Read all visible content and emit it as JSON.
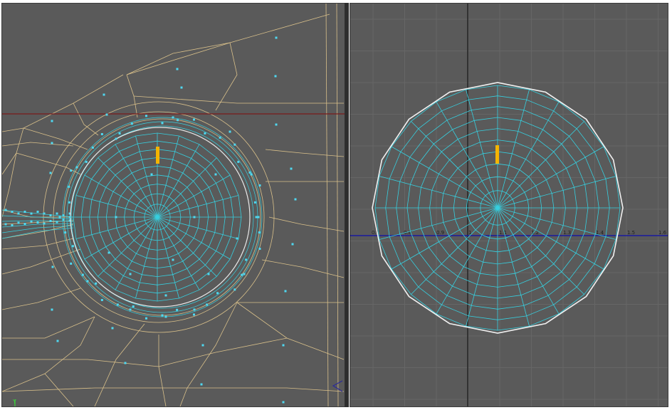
{
  "colors": {
    "viewport_bg": "#5a5a5a",
    "grid": "#666666",
    "wire_yellow": "#d9c08a",
    "wire_cyan": "#36d0e0",
    "vertex": "#4fd8f0",
    "selected_edge": "#ffffff",
    "pivot_marker": "#f4b400",
    "horizon_line": "#7a1a1a",
    "x_axis_line": "#1a1aa0",
    "y_axis_line": "#141414",
    "gizmo_green": "#3ad23a"
  },
  "viewport_left": {
    "axis_gizmo_label": "Y"
  },
  "viewport_right": {
    "axis_ticks": [
      "0.7",
      "0.8",
      "0.9",
      "1",
      "1.1",
      "1.2",
      "1.3",
      "1.4",
      "1.5",
      "1.6"
    ]
  }
}
